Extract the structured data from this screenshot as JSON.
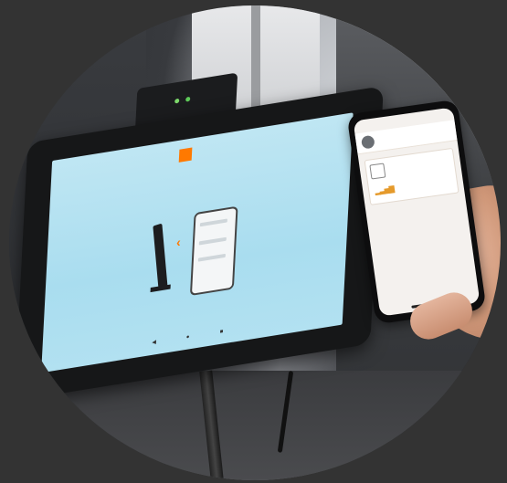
{
  "scene": {
    "description_label": "",
    "tablet": {
      "brand_logo_text": "",
      "instruction_text": "",
      "nav_icons": [
        "back-icon",
        "home-icon",
        "recents-icon"
      ]
    },
    "phone": {
      "status_time": "",
      "status_center": "",
      "app_name": "",
      "card_title": ""
    },
    "colors": {
      "background": "#333333",
      "screen": "#a9ddef",
      "brand_orange": "#ff7900"
    }
  }
}
